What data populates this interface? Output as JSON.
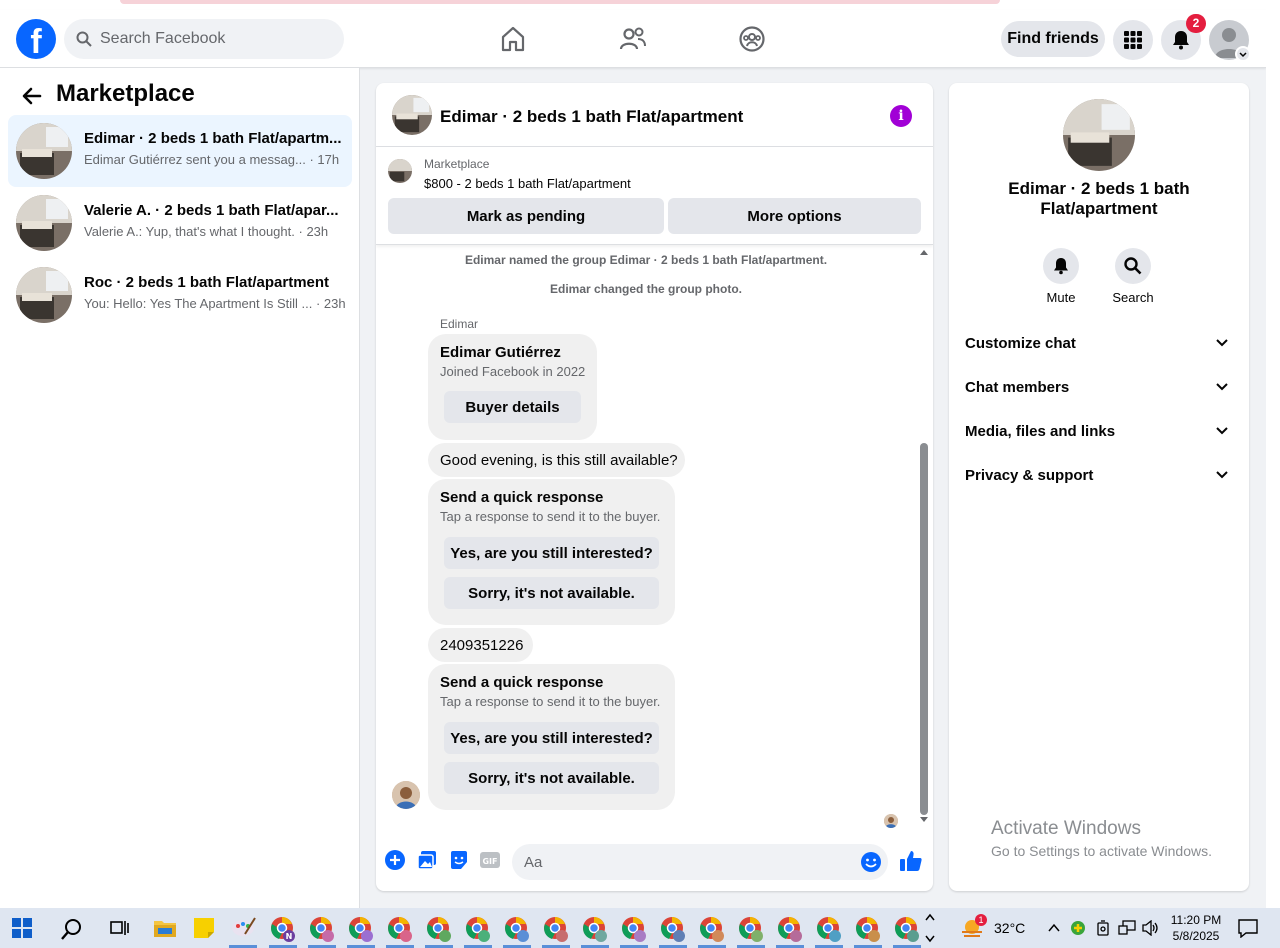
{
  "header": {
    "search_placeholder": "Search Facebook",
    "find_friends_label": "Find friends",
    "notification_count": "2",
    "nav_icons": [
      "home-icon",
      "friends-icon",
      "groups-icon"
    ],
    "brand_color": "#0866ff"
  },
  "sidebar": {
    "title": "Marketplace",
    "conversations": [
      {
        "title": "Edimar · 2 beds 1 bath Flat/apartm...",
        "preview": "Edimar Gutiérrez sent you a messag...",
        "time": "· 17h",
        "active": true
      },
      {
        "title": "Valerie A. · 2 beds 1 bath Flat/apar...",
        "preview": "Valerie A.: Yup, that's what I thought.",
        "time": "· 23h",
        "active": false
      },
      {
        "title": "Roc · 2 beds 1 bath Flat/apartment",
        "preview": "You: Hello: Yes The Apartment Is Still ...",
        "time": "· 23h",
        "active": false
      }
    ]
  },
  "chat": {
    "title": "Edimar · 2 beds 1 bath Flat/apartment",
    "listing": {
      "source": "Marketplace",
      "price_title": "$800 - 2 beds 1 bath Flat/apartment",
      "mark_pending": "Mark as pending",
      "more_options": "More options"
    },
    "system_messages": [
      "Edimar named the group Edimar · 2 beds 1 bath Flat/apartment.",
      "Edimar changed the group photo."
    ],
    "sender_name": "Edimar",
    "profile_card": {
      "name": "Edimar Gutiérrez",
      "joined": "Joined Facebook in 2022",
      "buyer_details": "Buyer details"
    },
    "message1": "Good evening, is this still available?",
    "quick_response_1": {
      "title": "Send a quick response",
      "subtitle": "Tap a response to send it to the buyer.",
      "option_yes": "Yes, are you still interested?",
      "option_no": "Sorry, it's not available."
    },
    "message2": "2409351226",
    "quick_response_2": {
      "title": "Send a quick response",
      "subtitle": "Tap a response to send it to the buyer.",
      "option_yes": "Yes, are you still interested?",
      "option_no": "Sorry, it's not available."
    },
    "composer_placeholder": "Aa"
  },
  "info_panel": {
    "name": "Edimar · 2 beds 1 bath Flat/apartment",
    "mute_label": "Mute",
    "search_label": "Search",
    "sections": [
      "Customize chat",
      "Chat members",
      "Media, files and links",
      "Privacy & support"
    ]
  },
  "watermark": {
    "line1": "Activate Windows",
    "line2": "Go to Settings to activate Windows."
  },
  "taskbar": {
    "weather": "32°C",
    "weather_badge": "1",
    "time": "11:20 PM",
    "date": "5/8/2025"
  }
}
